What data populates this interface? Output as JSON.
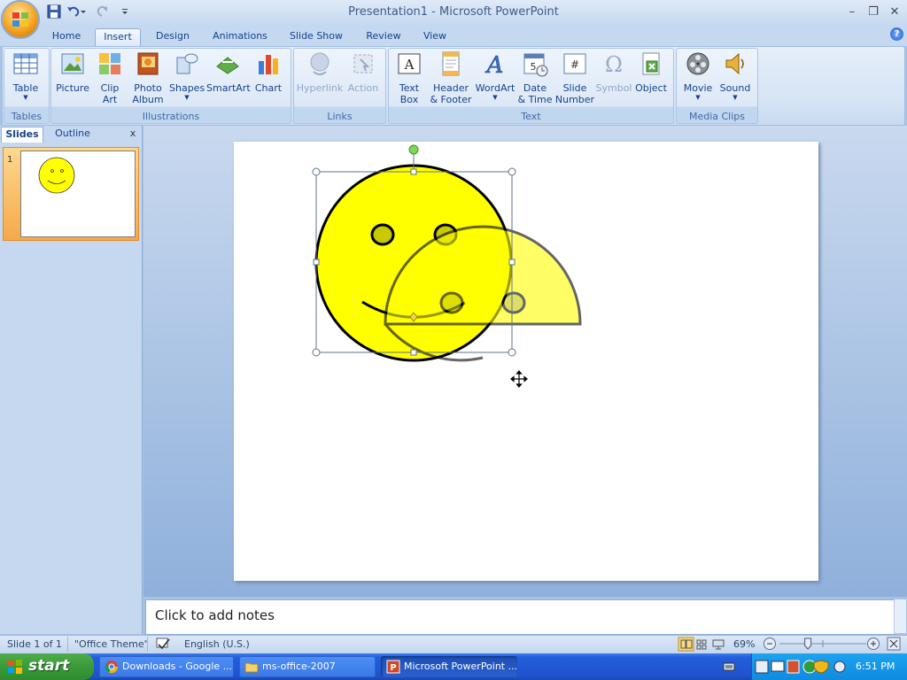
{
  "window": {
    "title": "Presentation1 - Microsoft PowerPoint",
    "minimize": "–",
    "restore": "❐",
    "close": "✕"
  },
  "tabs": [
    "Home",
    "Insert",
    "Design",
    "Animations",
    "Slide Show",
    "Review",
    "View"
  ],
  "active_tab": "Insert",
  "help": "?",
  "ribbon": {
    "groups": {
      "tables": "Tables",
      "illustrations": "Illustrations",
      "links": "Links",
      "text": "Text",
      "media": "Media Clips"
    },
    "buttons": {
      "table": "Table",
      "picture": "Picture",
      "clip_art_1": "Clip",
      "clip_art_2": "Art",
      "photo_album_1": "Photo",
      "photo_album_2": "Album",
      "shapes": "Shapes",
      "smartart": "SmartArt",
      "chart": "Chart",
      "hyperlink": "Hyperlink",
      "action": "Action",
      "text_box_1": "Text",
      "text_box_2": "Box",
      "header_footer_1": "Header",
      "header_footer_2": "& Footer",
      "wordart": "WordArt",
      "date_time_1": "Date",
      "date_time_2": "& Time",
      "slide_number_1": "Slide",
      "slide_number_2": "Number",
      "symbol": "Symbol",
      "object": "Object",
      "movie": "Movie",
      "sound": "Sound"
    }
  },
  "pane": {
    "tabs": [
      "Slides",
      "Outline"
    ],
    "close": "x",
    "slide_number": "1"
  },
  "notes": {
    "placeholder": "Click to add notes"
  },
  "status": {
    "slide": "Slide 1 of 1",
    "theme": "\"Office Theme\"",
    "language": "English (U.S.)",
    "zoom": "69%",
    "zoom_level": 0.69
  },
  "taskbar": {
    "start": "start",
    "tasks": [
      "Downloads - Google ...",
      "ms-office-2007",
      "Microsoft PowerPoint ..."
    ],
    "clock": "6:51 PM"
  },
  "colors": {
    "face_fill": "#ffff00",
    "ghost_fill": "#ffff66",
    "selection_handle": "#ffffff",
    "rotation_handle": "#7ed957"
  }
}
